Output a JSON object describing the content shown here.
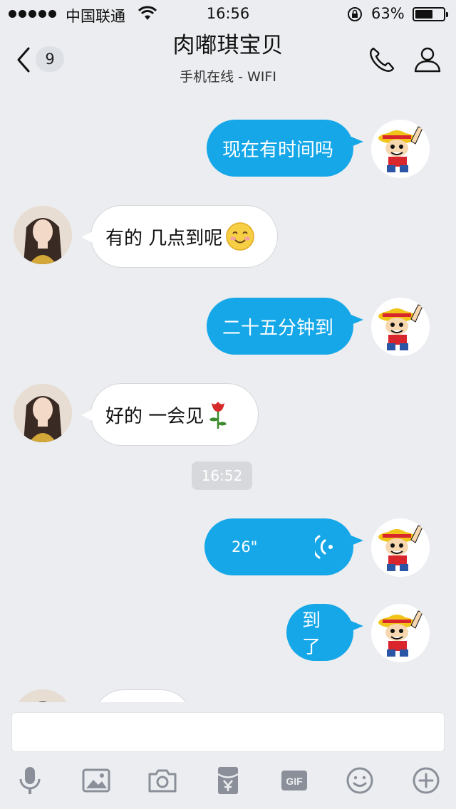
{
  "status": {
    "carrier": "中国联通",
    "time": "16:56",
    "battery_percent": "63%",
    "battery_level": 0.63
  },
  "nav": {
    "unread_count": "9",
    "title": "肉嘟琪宝贝",
    "subtitle": "手机在线 - WIFI"
  },
  "messages": [
    {
      "from": "me",
      "text": "现在有时间吗"
    },
    {
      "from": "her",
      "text": "有的 几点到呢",
      "emoji": "smile-emoji"
    },
    {
      "from": "me",
      "text": "二十五分钟到"
    },
    {
      "from": "her",
      "text": "好的 一会见",
      "emoji": "rose-emoji"
    },
    {
      "from": "me",
      "type": "voice",
      "duration": "26\""
    },
    {
      "from": "me",
      "text": "到了"
    }
  ],
  "timestamp": "16:52",
  "toolbar": {
    "icons": [
      "microphone-icon",
      "image-icon",
      "camera-icon",
      "red-packet-icon",
      "gif-icon",
      "emoji-icon",
      "plus-icon"
    ]
  },
  "colors": {
    "outgoing_bubble": "#16a7e8",
    "incoming_bubble": "#ffffff",
    "background": "#ebedf0"
  }
}
